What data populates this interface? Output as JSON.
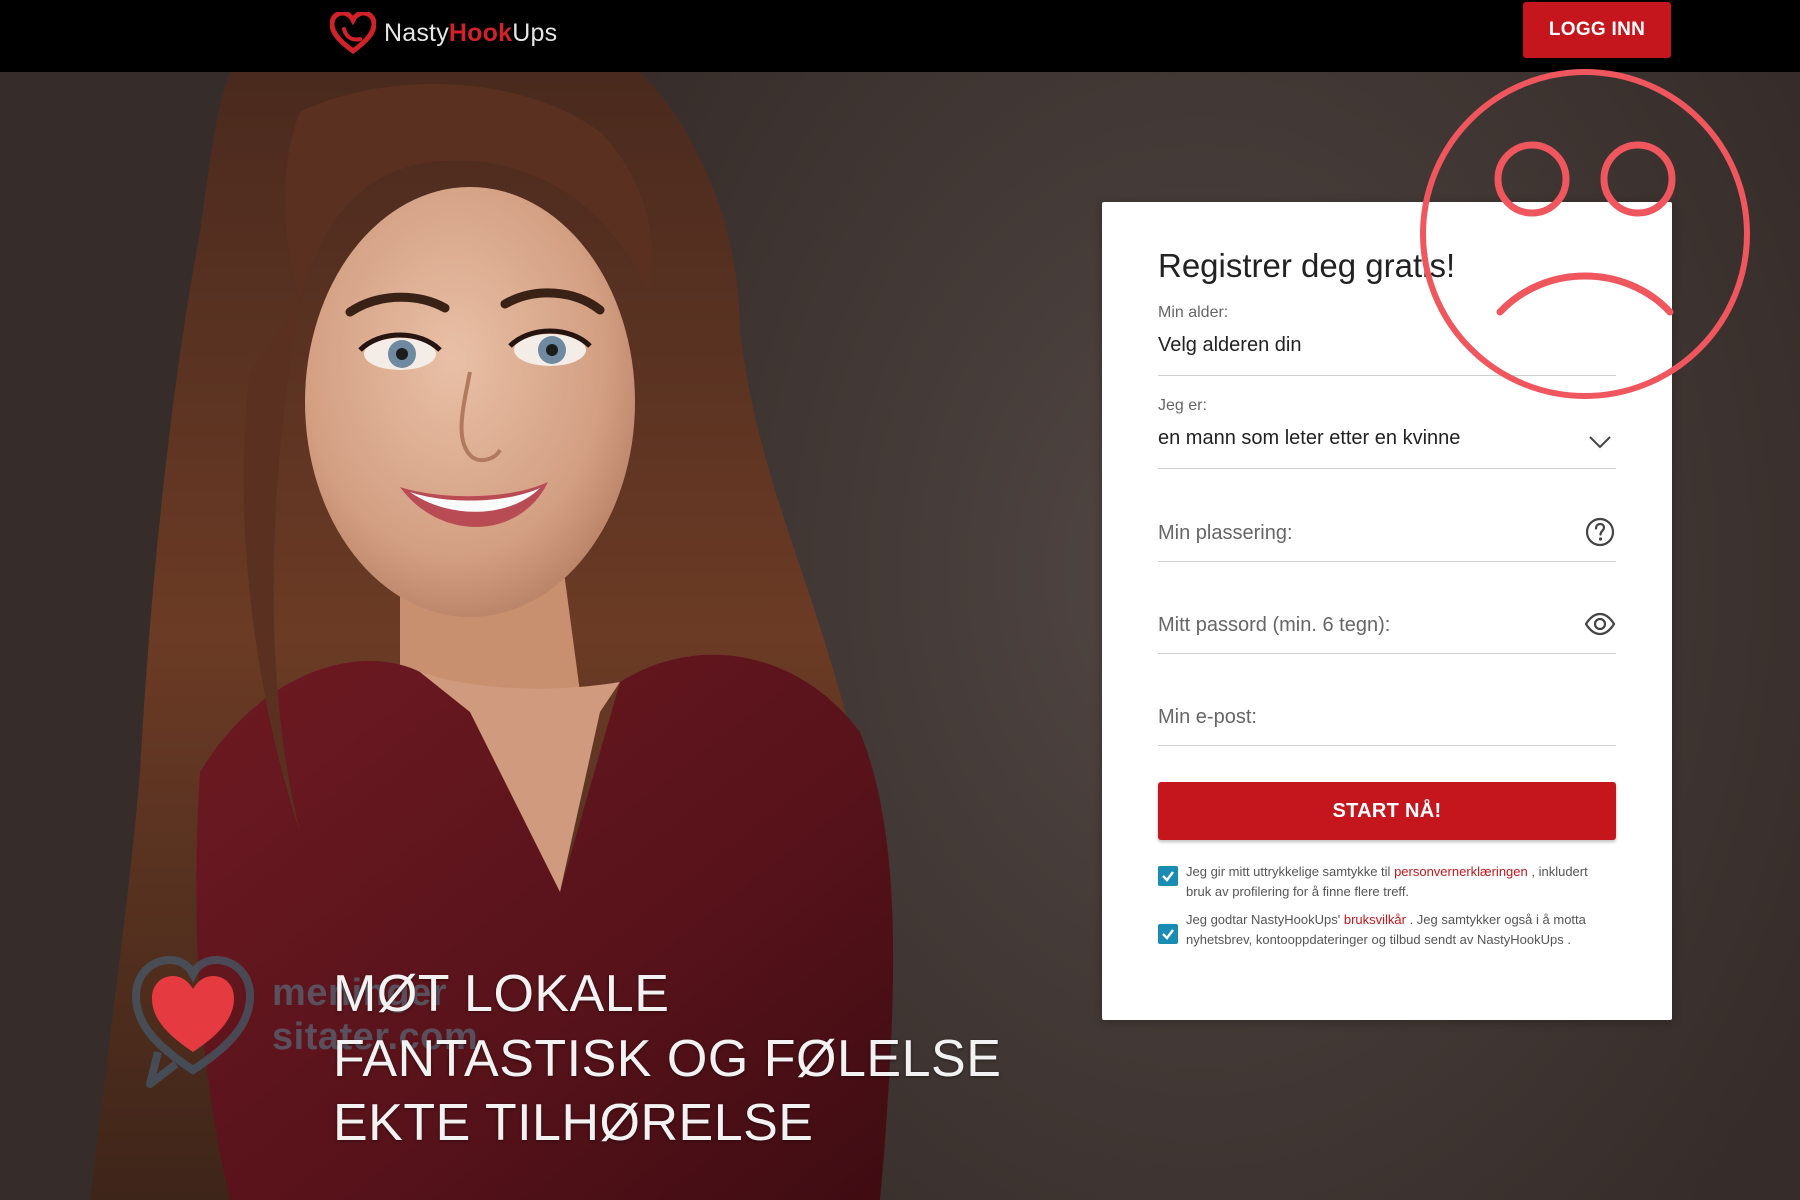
{
  "header": {
    "logo_nasty": "Nasty",
    "logo_hook": "Hook",
    "logo_ups": "Ups",
    "login_label": "LOGG INN"
  },
  "form": {
    "title": "Registrer deg gratis!",
    "age_label": "Min alder:",
    "age_value": "Velg alderen din",
    "gender_label": "Jeg er:",
    "gender_value": "en mann som leter etter en kvinne",
    "location_placeholder": "Min plassering:",
    "password_placeholder": "Mitt passord (min. 6 tegn):",
    "email_placeholder": "Min e-post:",
    "start_label": "START NÅ!",
    "consent1_pre": "Jeg gir mitt uttrykkelige samtykke til ",
    "consent1_link": "personvernerklæringen",
    "consent1_post": " , inkludert bruk av profilering for å finne flere treff.",
    "consent2_pre": "Jeg godtar NastyHookUps' ",
    "consent2_link": "bruksvilkår",
    "consent2_post": " . Jeg samtykker også i å motta nyhetsbrev, kontooppdateringer og tilbud sendt av NastyHookUps .",
    "consent1_checked": true,
    "consent2_checked": true
  },
  "tagline": {
    "line1": "MØT LOKALE",
    "line2": "FANTASTISK OG FØLELSE",
    "line3": "EKTE TILHØRELSE"
  },
  "watermark": {
    "line1": "meninger",
    "line2": "sitater.com"
  },
  "colors": {
    "brand_red": "#c4161c",
    "topbar": "#000000",
    "checkbox": "#1a8bb3",
    "sad_face": "#f0565e"
  }
}
